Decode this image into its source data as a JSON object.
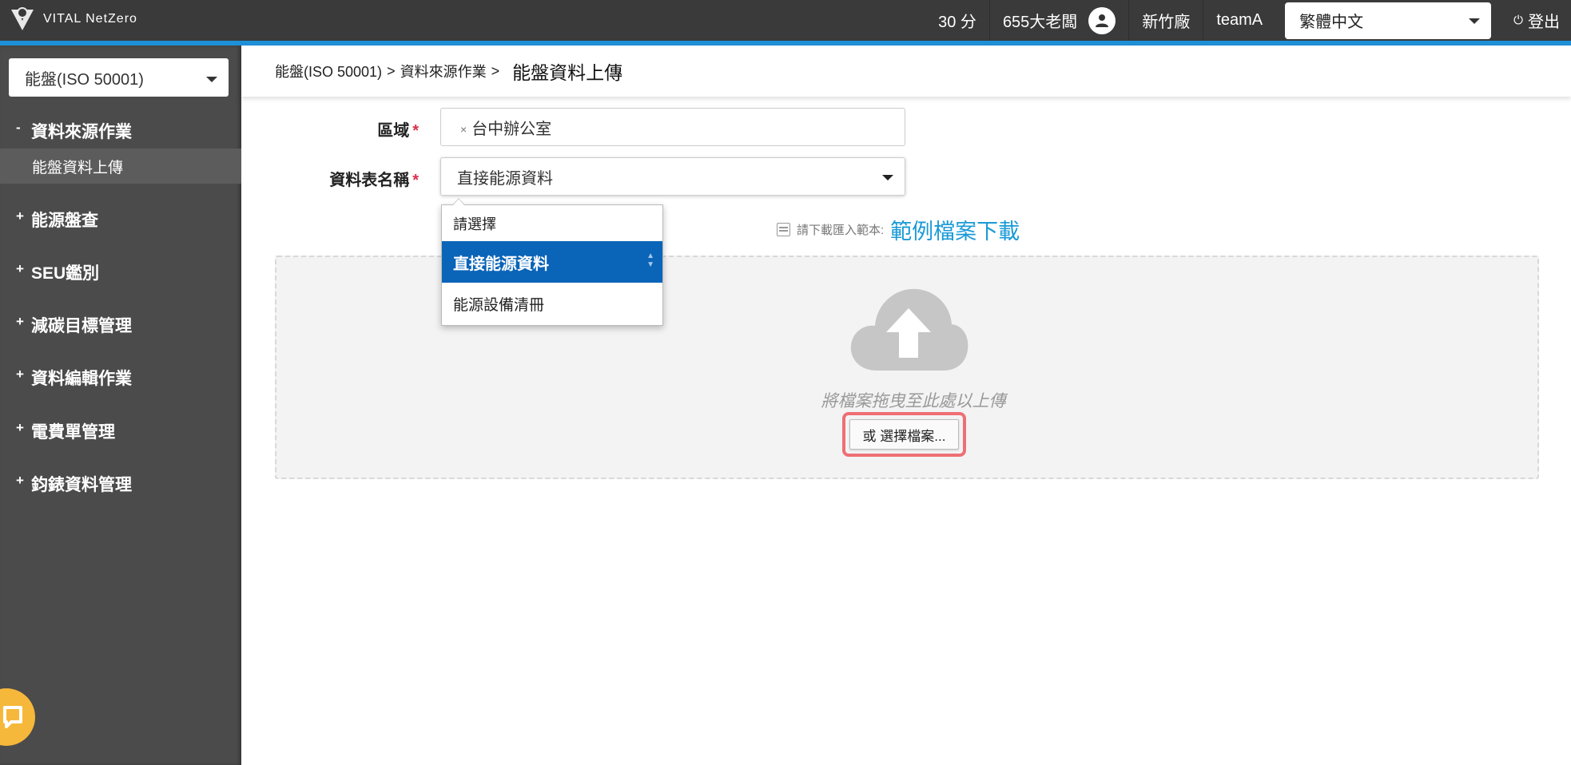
{
  "header": {
    "brand": "VITAL NetZero",
    "score": "30 分",
    "user_name": "655大老闆",
    "site": "新竹廠",
    "team": "teamA",
    "language": "繁體中文",
    "logout_label": "登出"
  },
  "sidebar": {
    "module_select": "能盤(ISO 50001)",
    "expanded_group": {
      "sign": "-",
      "label": "資料來源作業"
    },
    "active_item": "能盤資料上傳",
    "groups": [
      {
        "sign": "+",
        "label": "能源盤查"
      },
      {
        "sign": "+",
        "label": "SEU鑑別"
      },
      {
        "sign": "+",
        "label": "減碳目標管理"
      },
      {
        "sign": "+",
        "label": "資料編輯作業"
      },
      {
        "sign": "+",
        "label": "電費單管理"
      },
      {
        "sign": "+",
        "label": "鈞錶資料管理"
      }
    ]
  },
  "breadcrumb": {
    "items": [
      "能盤(ISO 50001)",
      "資料來源作業"
    ],
    "separator": ">",
    "current": "能盤資料上傳"
  },
  "form": {
    "area_label": "區域",
    "required_mark": "*",
    "area_tag": "台中辦公室",
    "area_tag_remove": "×",
    "sheet_label": "資料表名稱",
    "sheet_value": "直接能源資料",
    "sheet_options": [
      "請選擇",
      "直接能源資料",
      "能源設備清冊"
    ],
    "sheet_selected_index": 1
  },
  "template": {
    "hint": "請下載匯入範本:",
    "link": "範例檔案下載"
  },
  "dropzone": {
    "drag_text": "將檔案拖曳至此處以上傳",
    "choose_button": "或 選擇檔案..."
  },
  "colors": {
    "topbar": "#3a3a3a",
    "accent": "#1e90d8",
    "sidebar": "#4b4b4b",
    "selected_option": "#0a64b8",
    "link": "#1a9ad6",
    "required": "#d9304b",
    "highlight": "#ee6f74",
    "chat": "#f6b83a"
  }
}
